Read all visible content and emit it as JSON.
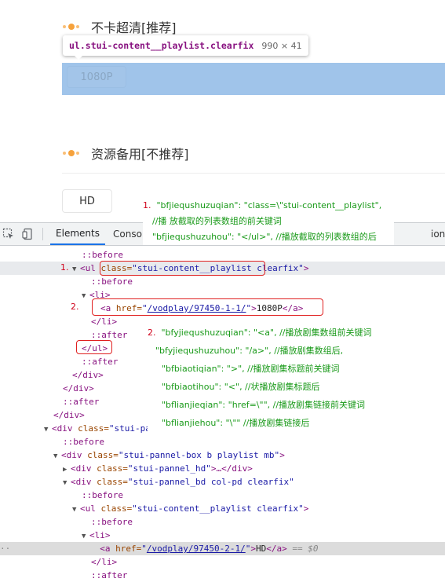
{
  "page": {
    "section1_title": "不卡超清[推荐]",
    "section2_title": "资源备用[不推荐]",
    "episode_1080": "1080P",
    "episode_hd": "HD"
  },
  "tooltip": {
    "selector": "ul.stui-content__playlist.clearfix",
    "dimensions": "990 × 41"
  },
  "devtools": {
    "tabs": [
      "Elements",
      "Consol",
      "ion"
    ],
    "rows": {
      "r0_pseudo": "::before",
      "r1_tag_open": "<ul ",
      "r1_attr": "class=",
      "r1_val": "\"stui-content__playlist",
      "r1_val_rest": " clearfix\"",
      "r1_close": ">",
      "r2_pseudo": "::before",
      "r3_tag": "<li>",
      "r4_tag": "<a ",
      "r4_attr": "href=",
      "r4_link": "/vodplay/97450-1-1/",
      "r4_text": "1080P",
      "r4_close": "</a>",
      "r5_tag": "</li>",
      "r6_pseudo": "::after",
      "r7_tag": "</ul>",
      "r8_pseudo": "::after",
      "r9_tag": "</div>",
      "r10_tag": "</div>",
      "r11_pseudo": "::after",
      "r12_tag": "</div>",
      "r13_open": "<div ",
      "r13_attr": "class=",
      "r13_val": "\"stui-pa",
      "r14_pseudo": "::before",
      "r15_open": "<div ",
      "r15_attr": "class=",
      "r15_val": "\"stui-pannel-box b playlist mb\"",
      "r16_open": "<div ",
      "r16_attr": "class=",
      "r16_val": "\"stui-pannel_hd\"",
      "r16_rest": ">…</div>",
      "r17_open": "<div ",
      "r17_attr": "class=",
      "r17_val": "\"stui-pannel_bd col-pd clearfix\"",
      "r18_pseudo": "::before",
      "r19_open": "<ul ",
      "r19_attr": "class=",
      "r19_val": "\"stui-content__playlist clearfix\"",
      "r20_pseudo": "::before",
      "r21_tag": "<li>",
      "r22_open": "<a ",
      "r22_attr": "href=",
      "r22_link": "/vodplay/97450-2-1/",
      "r22_text": "HD",
      "r22_close": "</a>",
      "r22_eq": " == $0",
      "r23_tag": "</li>",
      "r24_pseudo": "::after"
    }
  },
  "annotations": {
    "box1": {
      "num": "1.",
      "line1": "\"bfjiequshuzuqian\": \"class=\\\"stui-content__playlist\",",
      "line2": "//播 放截取的列表数组的前关键词",
      "line3": "\"bfjiequshuzuhou\": \"</ul>\",  //播放截取的列表数组的后"
    },
    "box2": {
      "num": "2.",
      "line1": "\"bfyjiequshuzuqian\": \"<a\",  //播放剧集数组前关键词",
      "line2": "\"bfyjiequshuzuhou\": \"/a>\",  //播放剧集数组后,",
      "line3": "\"bfbiaotiqian\": \">\",  //播放剧集标题前关键词",
      "line4": "\"bfbiaotihou\": \"<\",  //状播放剧集标题后",
      "line5": "\"bflianjieqian\": \"href=\\\"\",  //播放剧集链接前关键词",
      "line6": "\"bflianjiehou\": \"\\\"\"  //播放剧集链接后"
    },
    "side_num1": "1.",
    "side_num2": "2."
  },
  "colors": {
    "highlight": "#a0c4ea",
    "annotation_text": "#1a9a1a",
    "annotation_number": "#d0021b",
    "red_box": "#e02020"
  }
}
